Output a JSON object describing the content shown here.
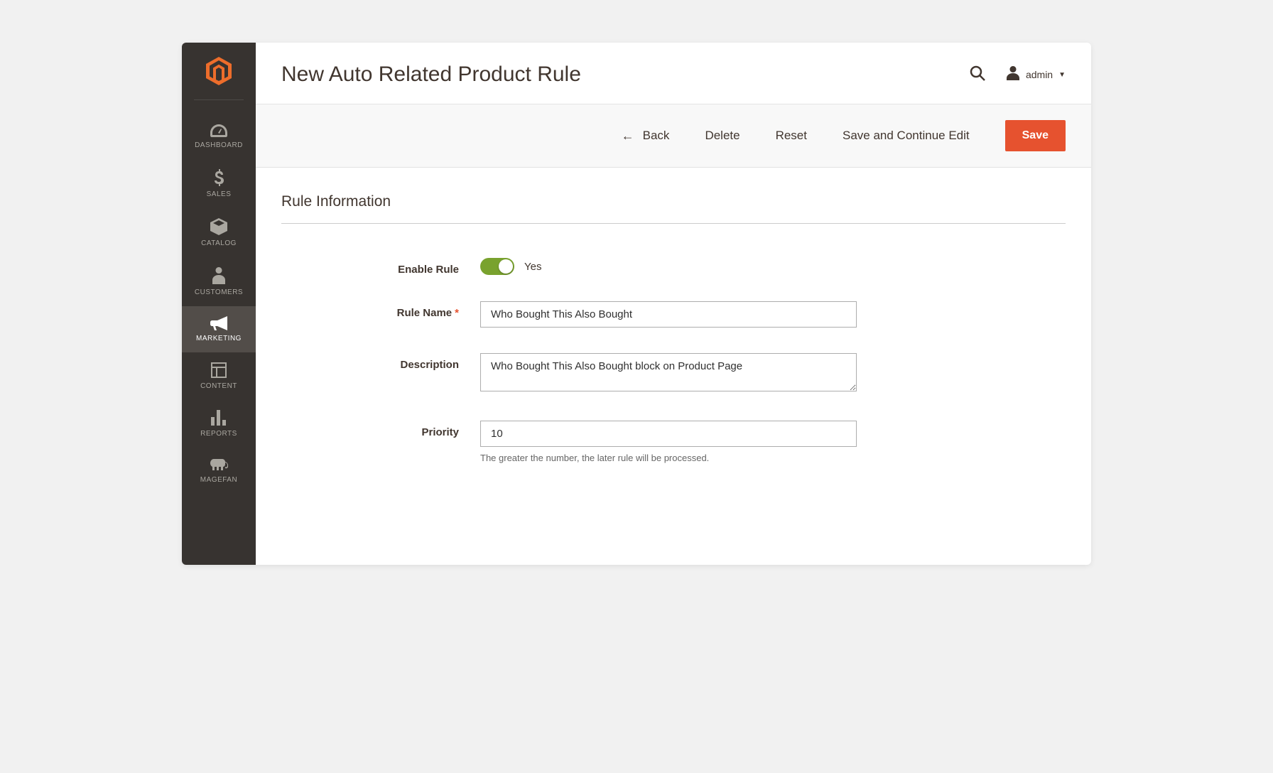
{
  "header": {
    "page_title": "New Auto Related Product Rule",
    "user_label": "admin"
  },
  "sidebar": {
    "items": [
      {
        "label": "DASHBOARD",
        "icon": "dashboard"
      },
      {
        "label": "SALES",
        "icon": "dollar"
      },
      {
        "label": "CATALOG",
        "icon": "box"
      },
      {
        "label": "CUSTOMERS",
        "icon": "person"
      },
      {
        "label": "MARKETING",
        "icon": "megaphone",
        "active": true
      },
      {
        "label": "CONTENT",
        "icon": "layout"
      },
      {
        "label": "REPORTS",
        "icon": "bar-chart"
      },
      {
        "label": "MAGEFAN",
        "icon": "elephant"
      }
    ]
  },
  "actions": {
    "back_label": "Back",
    "delete_label": "Delete",
    "reset_label": "Reset",
    "save_continue_label": "Save and Continue Edit",
    "save_label": "Save"
  },
  "form": {
    "section_title": "Rule Information",
    "enable_rule_label": "Enable Rule",
    "enable_rule_value": "Yes",
    "rule_name_label": "Rule Name",
    "rule_name_value": "Who Bought This Also Bought",
    "description_label": "Description",
    "description_value": "Who Bought This Also Bought block on Product Page",
    "priority_label": "Priority",
    "priority_value": "10",
    "priority_hint": "The greater the number, the later rule will be processed."
  }
}
